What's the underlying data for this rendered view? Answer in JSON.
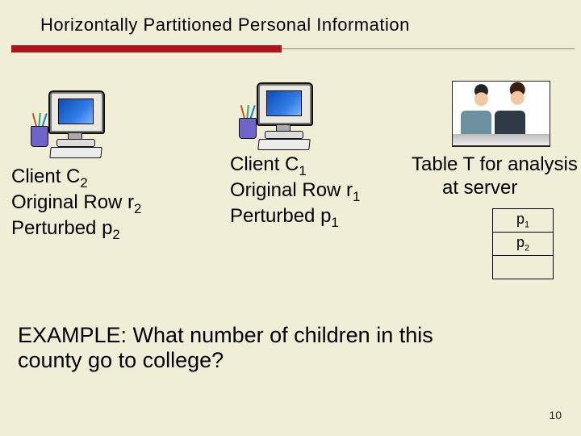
{
  "title": "Horizontally Partitioned Personal Information",
  "client2": {
    "line1_head": "Client C",
    "line1_sub": "2",
    "line2_head": "Original Row r",
    "line2_sub": "2",
    "line3_head": "Perturbed p",
    "line3_sub": "2"
  },
  "client1": {
    "line1_head": "Client C",
    "line1_sub": "1",
    "line2_head": "Original Row r",
    "line2_sub": "1",
    "line3_head": "Perturbed p",
    "line3_sub": "1"
  },
  "tablecap": {
    "l1": "Table T for analysis",
    "l2": "at server"
  },
  "rows": {
    "r1_head": "p",
    "r1_sub": "1",
    "r2_head": "p",
    "r2_sub": "2",
    "r3": ""
  },
  "example": {
    "l1": "EXAMPLE: What number of children in this",
    "l2": " county go to college?"
  },
  "page": "10",
  "icons": {
    "computer": "computer-icon",
    "people": "people-at-desk-icon"
  }
}
